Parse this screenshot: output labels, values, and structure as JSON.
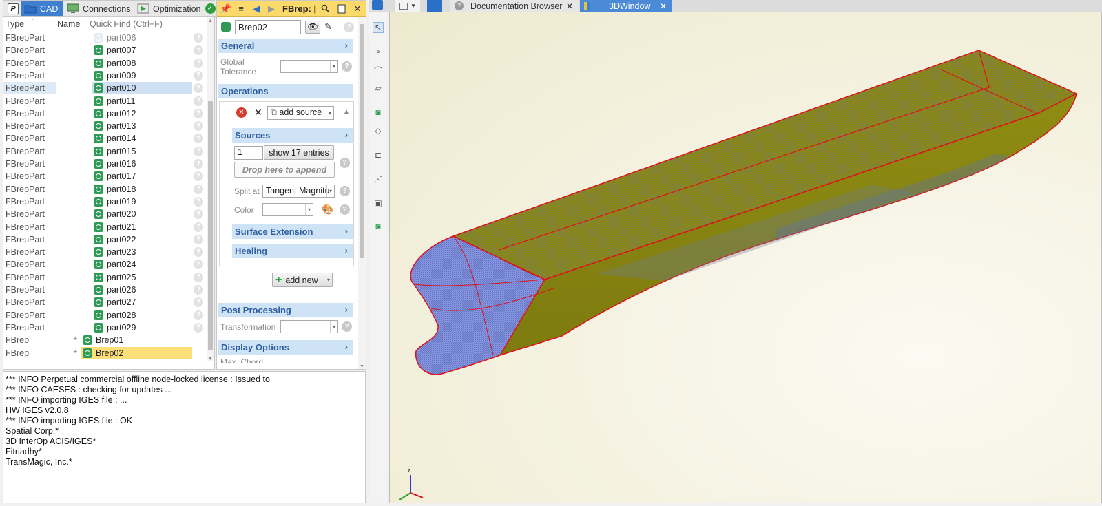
{
  "tree": {
    "tabs": [
      {
        "label": "P"
      },
      {
        "label": "CAD"
      },
      {
        "label": "Connections"
      },
      {
        "label": "Optimization"
      }
    ],
    "columns": {
      "type": "Type",
      "name": "Name",
      "quick_find": "Quick Find (Ctrl+F)"
    },
    "rows": [
      {
        "type": "FBrepPart",
        "name": "part006"
      },
      {
        "type": "FBrepPart",
        "name": "part007"
      },
      {
        "type": "FBrepPart",
        "name": "part008"
      },
      {
        "type": "FBrepPart",
        "name": "part009"
      },
      {
        "type": "FBrepPart",
        "name": "part010"
      },
      {
        "type": "FBrepPart",
        "name": "part011"
      },
      {
        "type": "FBrepPart",
        "name": "part012"
      },
      {
        "type": "FBrepPart",
        "name": "part013"
      },
      {
        "type": "FBrepPart",
        "name": "part014"
      },
      {
        "type": "FBrepPart",
        "name": "part015"
      },
      {
        "type": "FBrepPart",
        "name": "part016"
      },
      {
        "type": "FBrepPart",
        "name": "part017"
      },
      {
        "type": "FBrepPart",
        "name": "part018"
      },
      {
        "type": "FBrepPart",
        "name": "part019"
      },
      {
        "type": "FBrepPart",
        "name": "part020"
      },
      {
        "type": "FBrepPart",
        "name": "part021"
      },
      {
        "type": "FBrepPart",
        "name": "part022"
      },
      {
        "type": "FBrepPart",
        "name": "part023"
      },
      {
        "type": "FBrepPart",
        "name": "part024"
      },
      {
        "type": "FBrepPart",
        "name": "part025"
      },
      {
        "type": "FBrepPart",
        "name": "part026"
      },
      {
        "type": "FBrepPart",
        "name": "part027"
      },
      {
        "type": "FBrepPart",
        "name": "part028"
      },
      {
        "type": "FBrepPart",
        "name": "part029"
      },
      {
        "type": "FBrep",
        "name": "Brep01"
      },
      {
        "type": "FBrep",
        "name": "Brep02"
      }
    ]
  },
  "props": {
    "title": "FBrep: |",
    "object_name": "Brep02",
    "general": {
      "header": "General",
      "global_tolerance_label": "Global\nTolerance",
      "global_tolerance_value": ""
    },
    "operations": {
      "header": "Operations",
      "add_source": "add source",
      "sources_header": "Sources",
      "sources_index": "1",
      "show_entries": "show 17 entries",
      "drop_here": "Drop here to append",
      "split_at_label": "Split at",
      "split_at_value": "Tangent Magnitu",
      "color_label": "Color",
      "color_value": "",
      "surface_extension": "Surface Extension",
      "healing": "Healing",
      "add_new": "add new"
    },
    "post_processing": {
      "header": "Post Processing",
      "transformation_label": "Transformation",
      "transformation_value": ""
    },
    "display_options": {
      "header": "Display Options",
      "max_chord_label": "Max. Chord"
    }
  },
  "console": {
    "lines": [
      "*** INFO Perpetual commercial offline node-locked license : Issued to",
      "*** INFO CAESES : checking for updates ...",
      "*** INFO importing IGES file : ...",
      "HW IGES v2.0.8",
      "*** INFO importing IGES file : OK",
      "Spatial Corp.*",
      "3D InterOp ACIS/IGES*",
      "Fitriadhy*",
      "TransMagic, Inc.*"
    ]
  },
  "viewer": {
    "tabs": [
      {
        "label": "Documentation Browser"
      },
      {
        "label": "3DWindow"
      }
    ],
    "axis_label": "z"
  },
  "colors": {
    "accent_blue": "#3f7fd0",
    "toolbar_yellow": "#fbd96b",
    "section_blue": "#cfe3f7",
    "hull_olive": "#8f8c12",
    "hull_blue": "#7f8fe0",
    "edge_red": "#e0101a"
  }
}
